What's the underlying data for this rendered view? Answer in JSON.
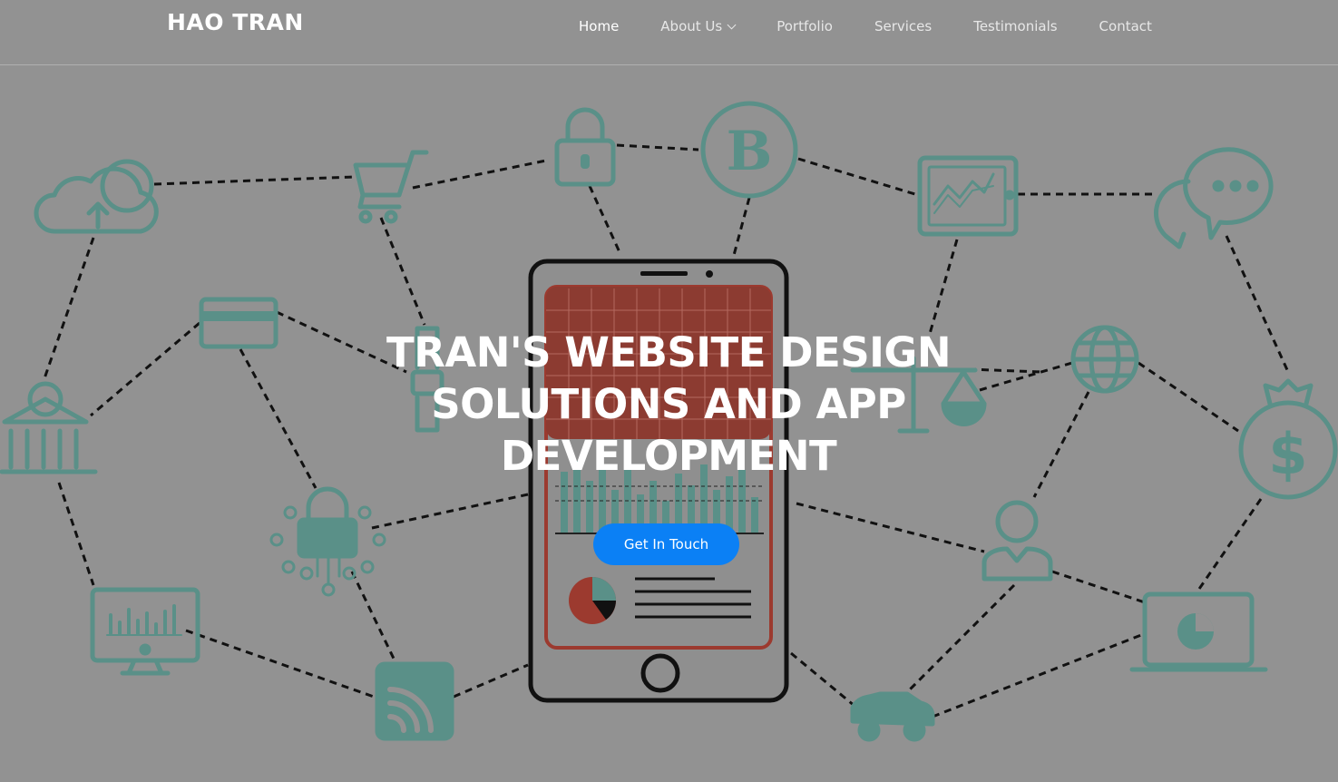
{
  "header": {
    "brand": "HAO TRAN",
    "nav": [
      {
        "label": "Home",
        "active": true
      },
      {
        "label": "About Us",
        "has_dropdown": true
      },
      {
        "label": "Portfolio"
      },
      {
        "label": "Services"
      },
      {
        "label": "Testimonials"
      },
      {
        "label": "Contact"
      }
    ]
  },
  "hero": {
    "title": "TRAN'S WEBSITE DESIGN SOLUTIONS AND APP DEVELOPMENT",
    "cta_label": "Get In Touch",
    "phone_screen_letter": "B",
    "money_symbol": "$"
  },
  "colors": {
    "background": "#929292",
    "icon_teal": "#5a9088",
    "accent_red": "#9c3a2f",
    "cta_blue": "#0b80f5",
    "text_white": "#ffffff"
  },
  "icons": [
    "cloud-upload-icon",
    "shopping-cart-icon",
    "padlock-icon",
    "bitcoin-icon",
    "tablet-chart-icon",
    "chat-bubbles-icon",
    "credit-card-icon",
    "bank-icon",
    "smartwatch-icon",
    "scales-icon",
    "globe-icon",
    "money-bag-icon",
    "circuit-lock-icon",
    "user-icon",
    "monitor-chart-icon",
    "rss-icon",
    "car-icon",
    "laptop-chart-icon",
    "smartphone-icon"
  ]
}
